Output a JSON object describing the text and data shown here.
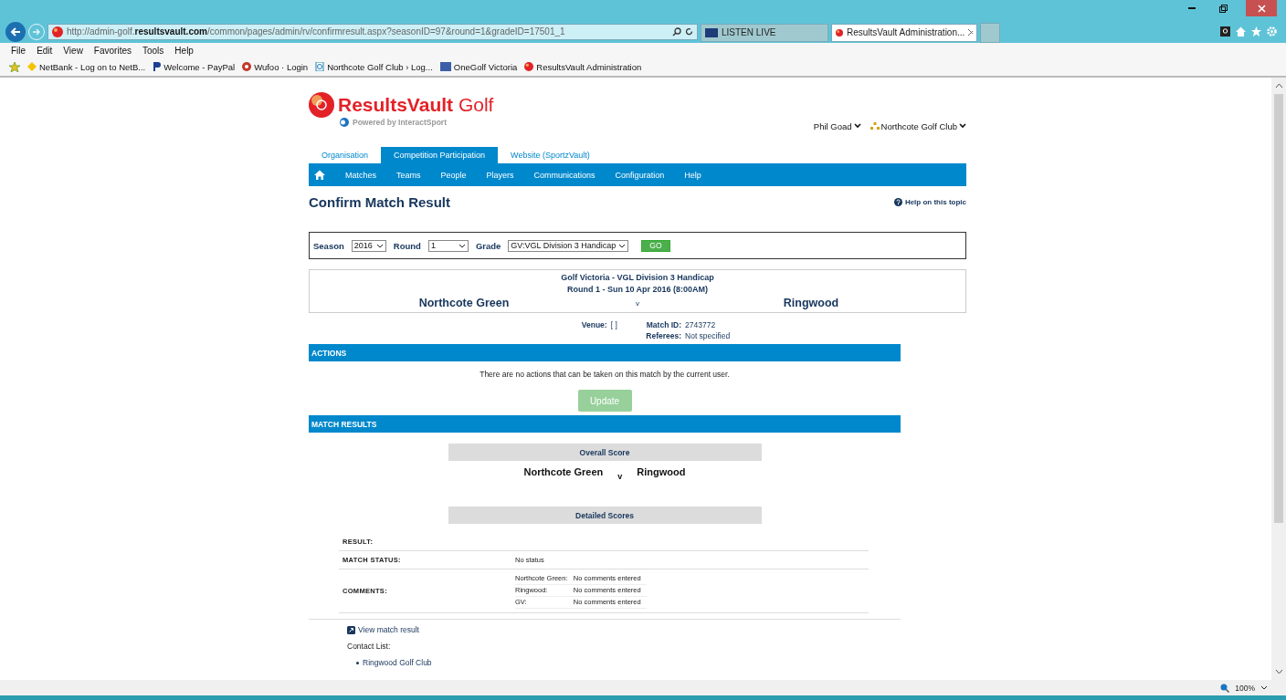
{
  "browser": {
    "url_prefix": "http://admin-golf.",
    "url_domain": "resultsvault.com",
    "url_rest": "/common/pages/admin/rv/confirmresult.aspx?seasonID=97&round=1&gradeID=17501_1",
    "tabs": [
      {
        "label": "LISTEN LIVE",
        "selected": false
      },
      {
        "label": "ResultsVault Administration...",
        "selected": true
      }
    ],
    "menu": [
      "File",
      "Edit",
      "View",
      "Favorites",
      "Tools",
      "Help"
    ],
    "favorites": [
      {
        "label": "NetBank - Log on to NetB...",
        "kind": "diamond"
      },
      {
        "label": "Welcome - PayPal",
        "kind": "p"
      },
      {
        "label": "Wufoo · Login",
        "kind": "w"
      },
      {
        "label": "Northcote Golf Club › Log...",
        "kind": "page"
      },
      {
        "label": "OneGolf Victoria",
        "kind": "square"
      },
      {
        "label": "ResultsVault Administration",
        "kind": "ball"
      }
    ],
    "zoom": "100%"
  },
  "header": {
    "brand": "ResultsVault",
    "brand_suffix": "Golf",
    "tagline": "Powered by InteractSport",
    "user": "Phil Goad",
    "club": "Northcote Golf Club"
  },
  "tabs": [
    {
      "label": "Organisation",
      "selected": false
    },
    {
      "label": "Competition Participation",
      "selected": true
    },
    {
      "label": "Website (SportzVault)",
      "selected": false
    }
  ],
  "nav": [
    "Matches",
    "Teams",
    "People",
    "Players",
    "Communications",
    "Configuration",
    "Help"
  ],
  "title": "Confirm Match Result",
  "help": "Help on this topic",
  "filters": [
    {
      "label": "Season",
      "value": "2016"
    },
    {
      "label": "Round",
      "value": "1"
    },
    {
      "label": "Grade",
      "value": "GV:VGL Division 3 Handicap"
    }
  ],
  "go": "GO",
  "match": {
    "competition": "Golf Victoria - VGL Division 3 Handicap",
    "round": "Round 1 - Sun 10 Apr 2016 (8:00AM)",
    "home": "Northcote Green",
    "vs": "v",
    "away": "Ringwood",
    "venue_label": "Venue:",
    "venue": "[ ]",
    "id_label": "Match ID:",
    "id": "2743772",
    "referees_label": "Referees:",
    "referees": "Not specified"
  },
  "actions": {
    "heading": "ACTIONS",
    "message": "There are no actions that can be taken on this match by the current user.",
    "button": "Update",
    "disabled": true
  },
  "results": {
    "heading": "MATCH RESULTS",
    "overall": "Overall Score",
    "home": "Northcote Green",
    "vs": "v",
    "away": "Ringwood",
    "detailed": "Detailed Scores",
    "result_label": "RESULT:",
    "status_label": "MATCH STATUS:",
    "status": "No status",
    "comments_label": "COMMENTS:",
    "comments": [
      {
        "team": "Northcote Green:",
        "text": "No comments entered"
      },
      {
        "team": "Ringwood:",
        "text": "No comments entered"
      },
      {
        "team": "GV:",
        "text": "No comments entered"
      }
    ]
  },
  "view_link": "View match result",
  "contact_label": "Contact List:",
  "contacts": [
    "Ringwood Golf Club"
  ]
}
